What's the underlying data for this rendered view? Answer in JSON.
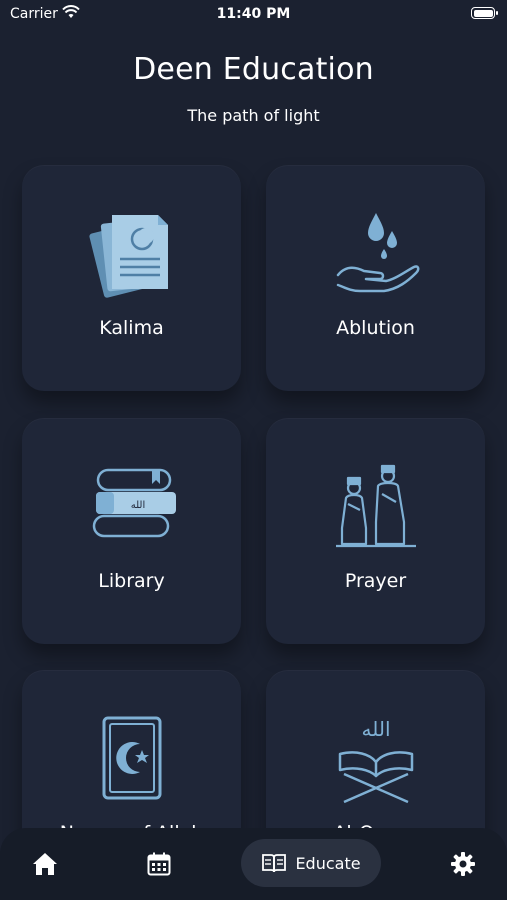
{
  "status_bar": {
    "carrier": "Carrier",
    "time": "11:40 PM"
  },
  "header": {
    "title": "Deen Education",
    "subtitle": "The path of light"
  },
  "cards": [
    {
      "label": "Kalima",
      "icon": "document-crescent-icon"
    },
    {
      "label": "Ablution",
      "icon": "water-hand-icon"
    },
    {
      "label": "Library",
      "icon": "books-icon"
    },
    {
      "label": "Prayer",
      "icon": "praying-people-icon"
    },
    {
      "label": "Names of Allah",
      "icon": "quran-book-icon"
    },
    {
      "label": "Al-Quran",
      "icon": "quran-stand-icon"
    }
  ],
  "bottom_nav": {
    "items": [
      {
        "icon": "home-icon"
      },
      {
        "icon": "calendar-icon"
      },
      {
        "label": "Educate",
        "icon": "open-book-icon",
        "active": true
      },
      {
        "icon": "gear-icon"
      }
    ]
  },
  "colors": {
    "background": "#1b2130",
    "card": "#1f2638",
    "icon_accent": "#7fb0d4",
    "nav": "#161c28"
  }
}
